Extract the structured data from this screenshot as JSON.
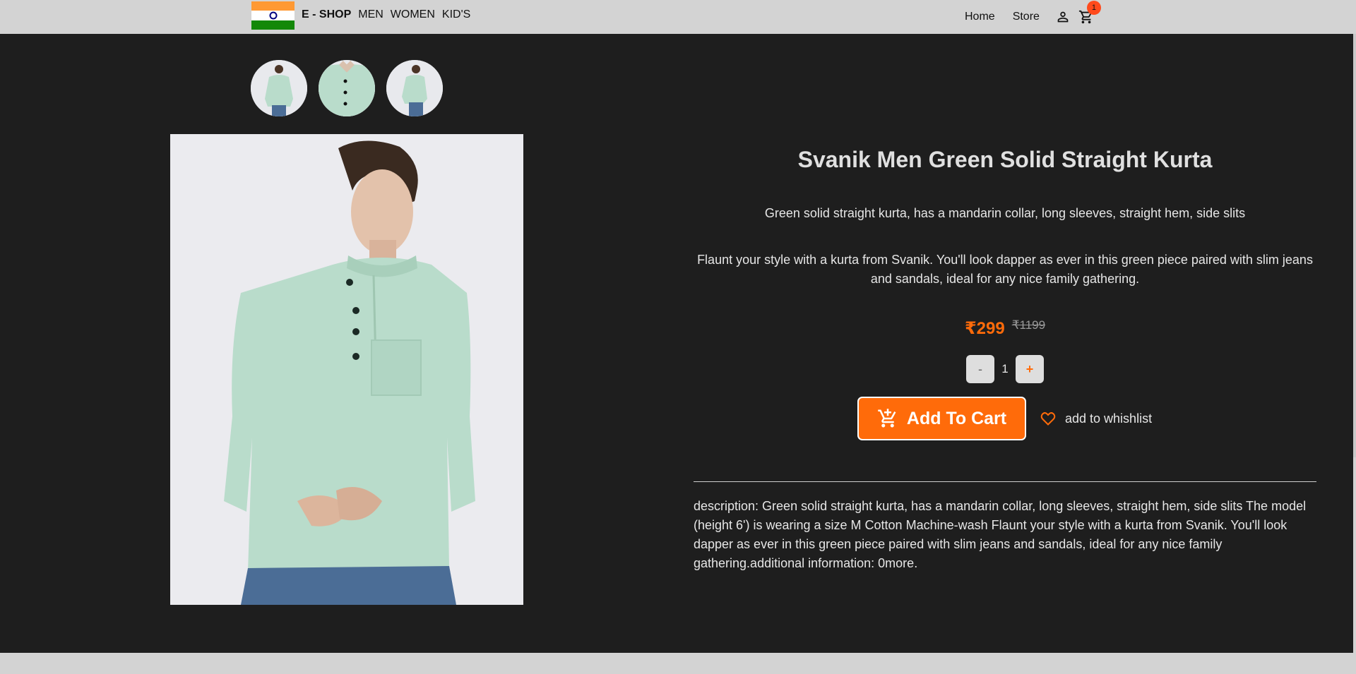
{
  "navbar": {
    "brand": "E - SHOP",
    "categories": [
      "MEN",
      "WOMEN",
      "KID'S"
    ],
    "links": [
      "Home",
      "Store"
    ],
    "cart_count": "1",
    "icons": {
      "user": "user-icon",
      "cart": "cart-icon",
      "logo": "india-flag-logo"
    }
  },
  "product": {
    "title": "Svanik Men Green Solid Straight Kurta",
    "short_description": "Green solid straight kurta, has a mandarin collar, long sleeves, straight hem, side slits",
    "long_description": "Flaunt your style with a kurta from Svanik. You'll look dapper as ever in this green piece paired with slim jeans and sandals, ideal for any nice family gathering.",
    "price": "₹299",
    "original_price": "₹1199",
    "quantity": "1",
    "decrement_label": "-",
    "increment_label": "+",
    "add_to_cart_label": "Add To Cart",
    "wishlist_label": "add to whishlist",
    "full_description": "description: Green solid straight kurta, has a mandarin collar, long sleeves, straight hem, side slits The model (height 6') is wearing a size M Cotton Machine-wash Flaunt your style with a kurta from Svanik. You'll look dapper as ever in this green piece paired with slim jeans and sandals, ideal for any nice family gathering.additional information: 0more."
  },
  "colors": {
    "accent": "#ff6b0a",
    "badge": "#ff4a1c",
    "background": "#1e1e1e",
    "navbar": "#d3d3d3",
    "kurta": "#b9dccb"
  }
}
